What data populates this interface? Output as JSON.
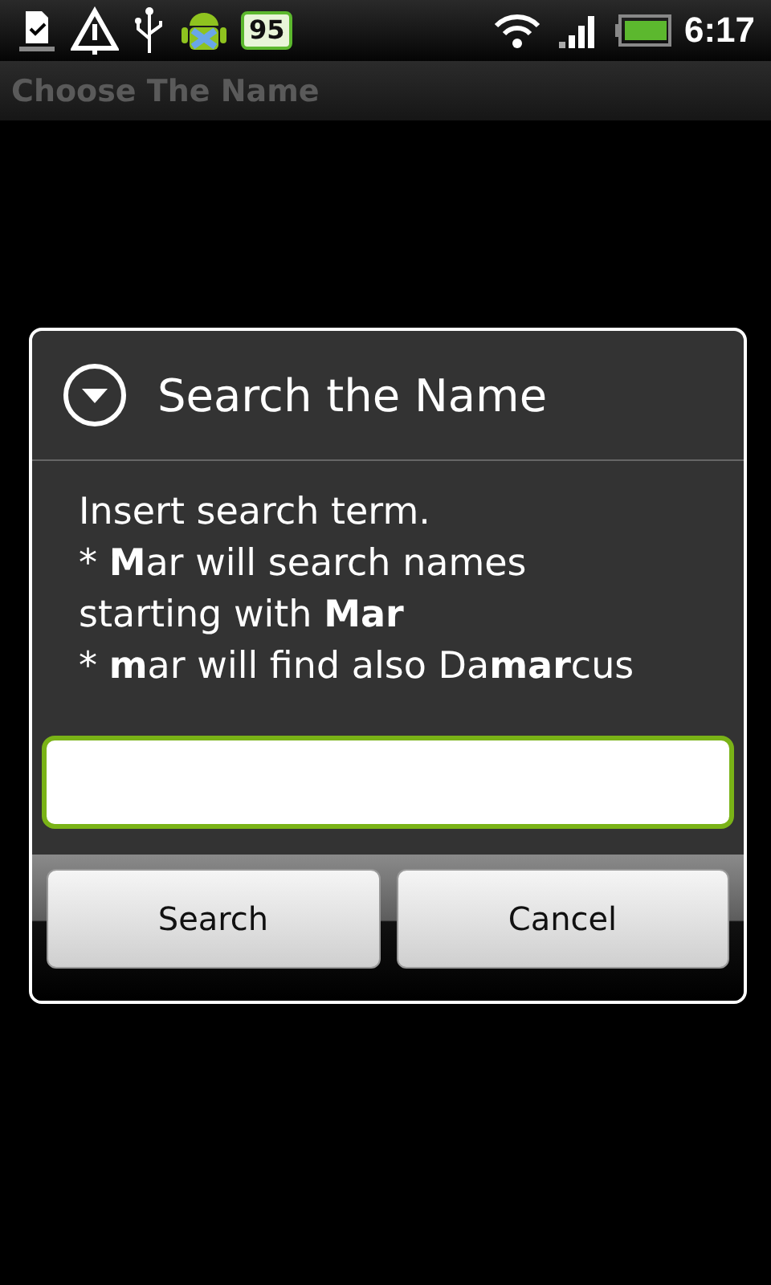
{
  "status_bar": {
    "battery_badge": "95",
    "time": "6:17"
  },
  "title_bar": {
    "title": "Choose The Name"
  },
  "dialog": {
    "title": "Search the Name",
    "message": [
      "Insert search term.",
      "* **M**ar will search names starting with **Mar**",
      "* **m**ar will find also Da**mar**cus"
    ],
    "search_field": {
      "focused": true
    },
    "buttons": [
      "Search",
      "Cancel"
    ]
  }
}
